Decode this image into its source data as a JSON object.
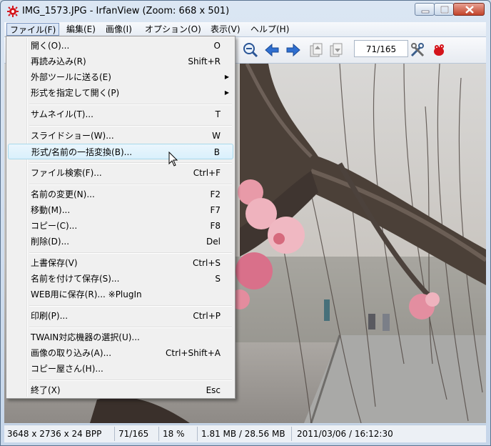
{
  "window": {
    "title": "IMG_1573.JPG - IrfanView (Zoom: 668 x 501)"
  },
  "menubar": {
    "items": [
      {
        "label": "ファイル(F)",
        "active": true
      },
      {
        "label": "編集(E)"
      },
      {
        "label": "画像(I)"
      },
      {
        "label": "オプション(O)"
      },
      {
        "label": "表示(V)"
      },
      {
        "label": "ヘルプ(H)"
      }
    ]
  },
  "toolbar": {
    "page_counter": "71/165",
    "icons": [
      "zoom-out-icon",
      "back-arrow-icon",
      "forward-arrow-icon",
      "copy-up-icon",
      "copy-down-icon",
      "tools-icon",
      "irfanview-logo-icon"
    ]
  },
  "file_menu": {
    "items": [
      {
        "label": "開く(O)...",
        "shortcut": "O"
      },
      {
        "label": "再読み込み(R)",
        "shortcut": "Shift+R"
      },
      {
        "label": "外部ツールに送る(E)",
        "submenu": true
      },
      {
        "label": "形式を指定して開く(P)",
        "submenu": true
      },
      {
        "label": "サムネイル(T)...",
        "shortcut": "T"
      },
      {
        "label": "スライドショー(W)...",
        "shortcut": "W"
      },
      {
        "label": "形式/名前の一括変換(B)...",
        "shortcut": "B",
        "highlighted": true
      },
      {
        "label": "ファイル検索(F)...",
        "shortcut": "Ctrl+F"
      },
      {
        "label": "名前の変更(N)...",
        "shortcut": "F2"
      },
      {
        "label": "移動(M)...",
        "shortcut": "F7"
      },
      {
        "label": "コピー(C)...",
        "shortcut": "F8"
      },
      {
        "label": "削除(D)...",
        "shortcut": "Del"
      },
      {
        "label": "上書保存(V)",
        "shortcut": "Ctrl+S"
      },
      {
        "label": "名前を付けて保存(S)...",
        "shortcut": "S"
      },
      {
        "label": "WEB用に保存(R)... ※PlugIn",
        "shortcut": ""
      },
      {
        "label": "印刷(P)...",
        "shortcut": "Ctrl+P"
      },
      {
        "label": "TWAIN対応機器の選択(U)...",
        "shortcut": ""
      },
      {
        "label": "画像の取り込み(A)...",
        "shortcut": "Ctrl+Shift+A"
      },
      {
        "label": "コピー屋さん(H)...",
        "shortcut": ""
      },
      {
        "label": "終了(X)",
        "shortcut": "Esc"
      }
    ]
  },
  "statusbar": {
    "dimensions": "3648 x 2736 x 24 BPP",
    "index": "71/165",
    "zoom": "18 %",
    "size": "1.81 MB / 28.56 MB",
    "datetime": "2011/03/06 / 16:12:30"
  },
  "colors": {
    "menu_highlight": "#d9f0fc",
    "arrow_blue": "#2f6fd0",
    "blossom_pink": "#e89aa8"
  }
}
